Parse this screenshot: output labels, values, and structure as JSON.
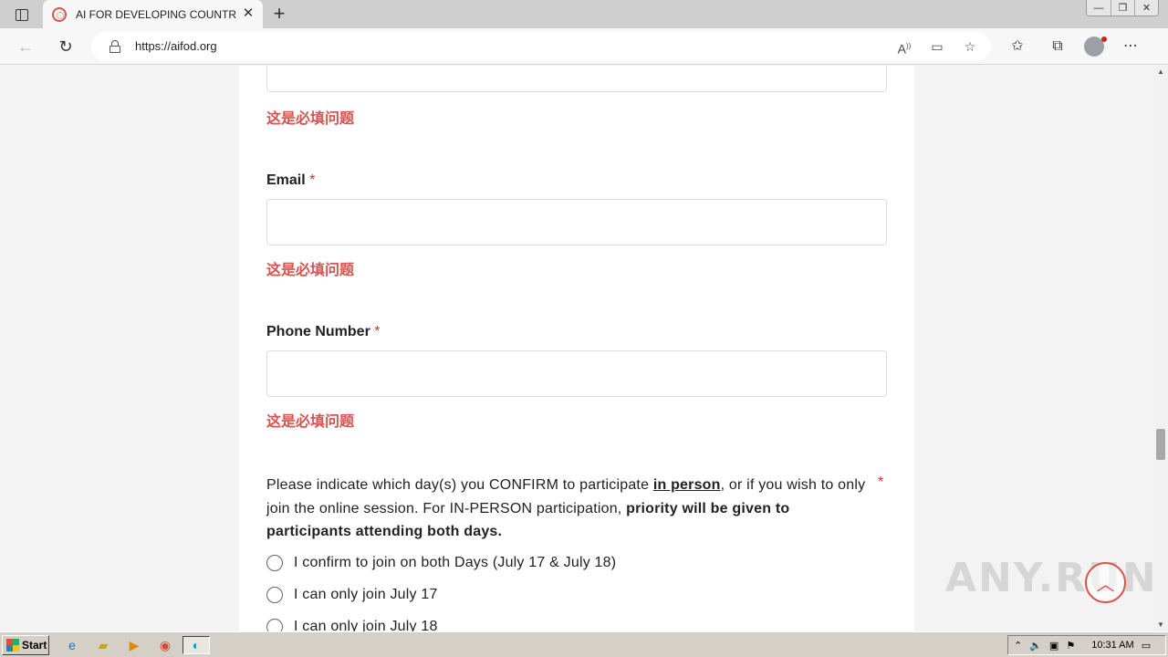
{
  "browser": {
    "tab_title": "AI FOR DEVELOPING COUNTRIES",
    "url": "https://aifod.org"
  },
  "form": {
    "error_text": "这是必填问题",
    "email_label": "Email",
    "phone_label": "Phone Number",
    "required_mark": "*",
    "question": {
      "part1": "Please indicate which day(s) you CONFIRM to participate ",
      "underlined": "in person",
      "part2": ", or if you wish to only join the online session. For IN-PERSON participation, ",
      "bold": "priority will be given to participants attending both days."
    },
    "options": [
      "I confirm to join on both Days (July 17 & July 18)",
      "I can only join July 17",
      "I can only join July 18"
    ]
  },
  "taskbar": {
    "start_label": "Start",
    "clock": "10:31 AM"
  },
  "watermark": "ANY.RUN",
  "colors": {
    "error": "#d9534f",
    "required": "#d93025",
    "accent": "#d9534f"
  }
}
